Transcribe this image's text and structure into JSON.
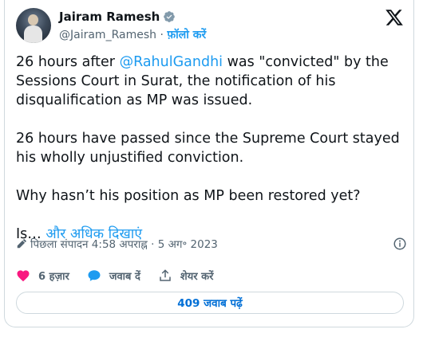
{
  "author": {
    "name": "Jairam Ramesh",
    "handle": "@Jairam_Ramesh",
    "separator": "·",
    "follow_label": "फ़ॉलो करें"
  },
  "tweet": {
    "mention": "@RahulGandhi",
    "para1_before": "26 hours after ",
    "para1_after": " was \"convicted\" by the Sessions Court in Surat, the notification of his disqualification as MP was issued.",
    "para2": "26 hours have passed since the Supreme Court stayed his wholly unjustified conviction.",
    "para3": "Why hasn’t his position as MP been restored yet?",
    "para4": "Is…",
    "show_more": "और अधिक दिखाएं"
  },
  "meta": {
    "edited_time": "पिछला संपादन 4:58 अपराह्न · 5 अग॰ 2023"
  },
  "actions": {
    "likes": "6 हज़ार",
    "reply_label": "जवाब दें",
    "share_label": "शेयर करें"
  },
  "replies_button": "409 जवाब पढ़ें",
  "colors": {
    "accent": "#1d9bf0",
    "like": "#f91880",
    "text_secondary": "#536471"
  },
  "icons": [
    "verified-badge-icon",
    "x-logo-icon",
    "pencil-icon",
    "info-icon",
    "heart-icon",
    "reply-bubble-icon",
    "share-icon"
  ]
}
